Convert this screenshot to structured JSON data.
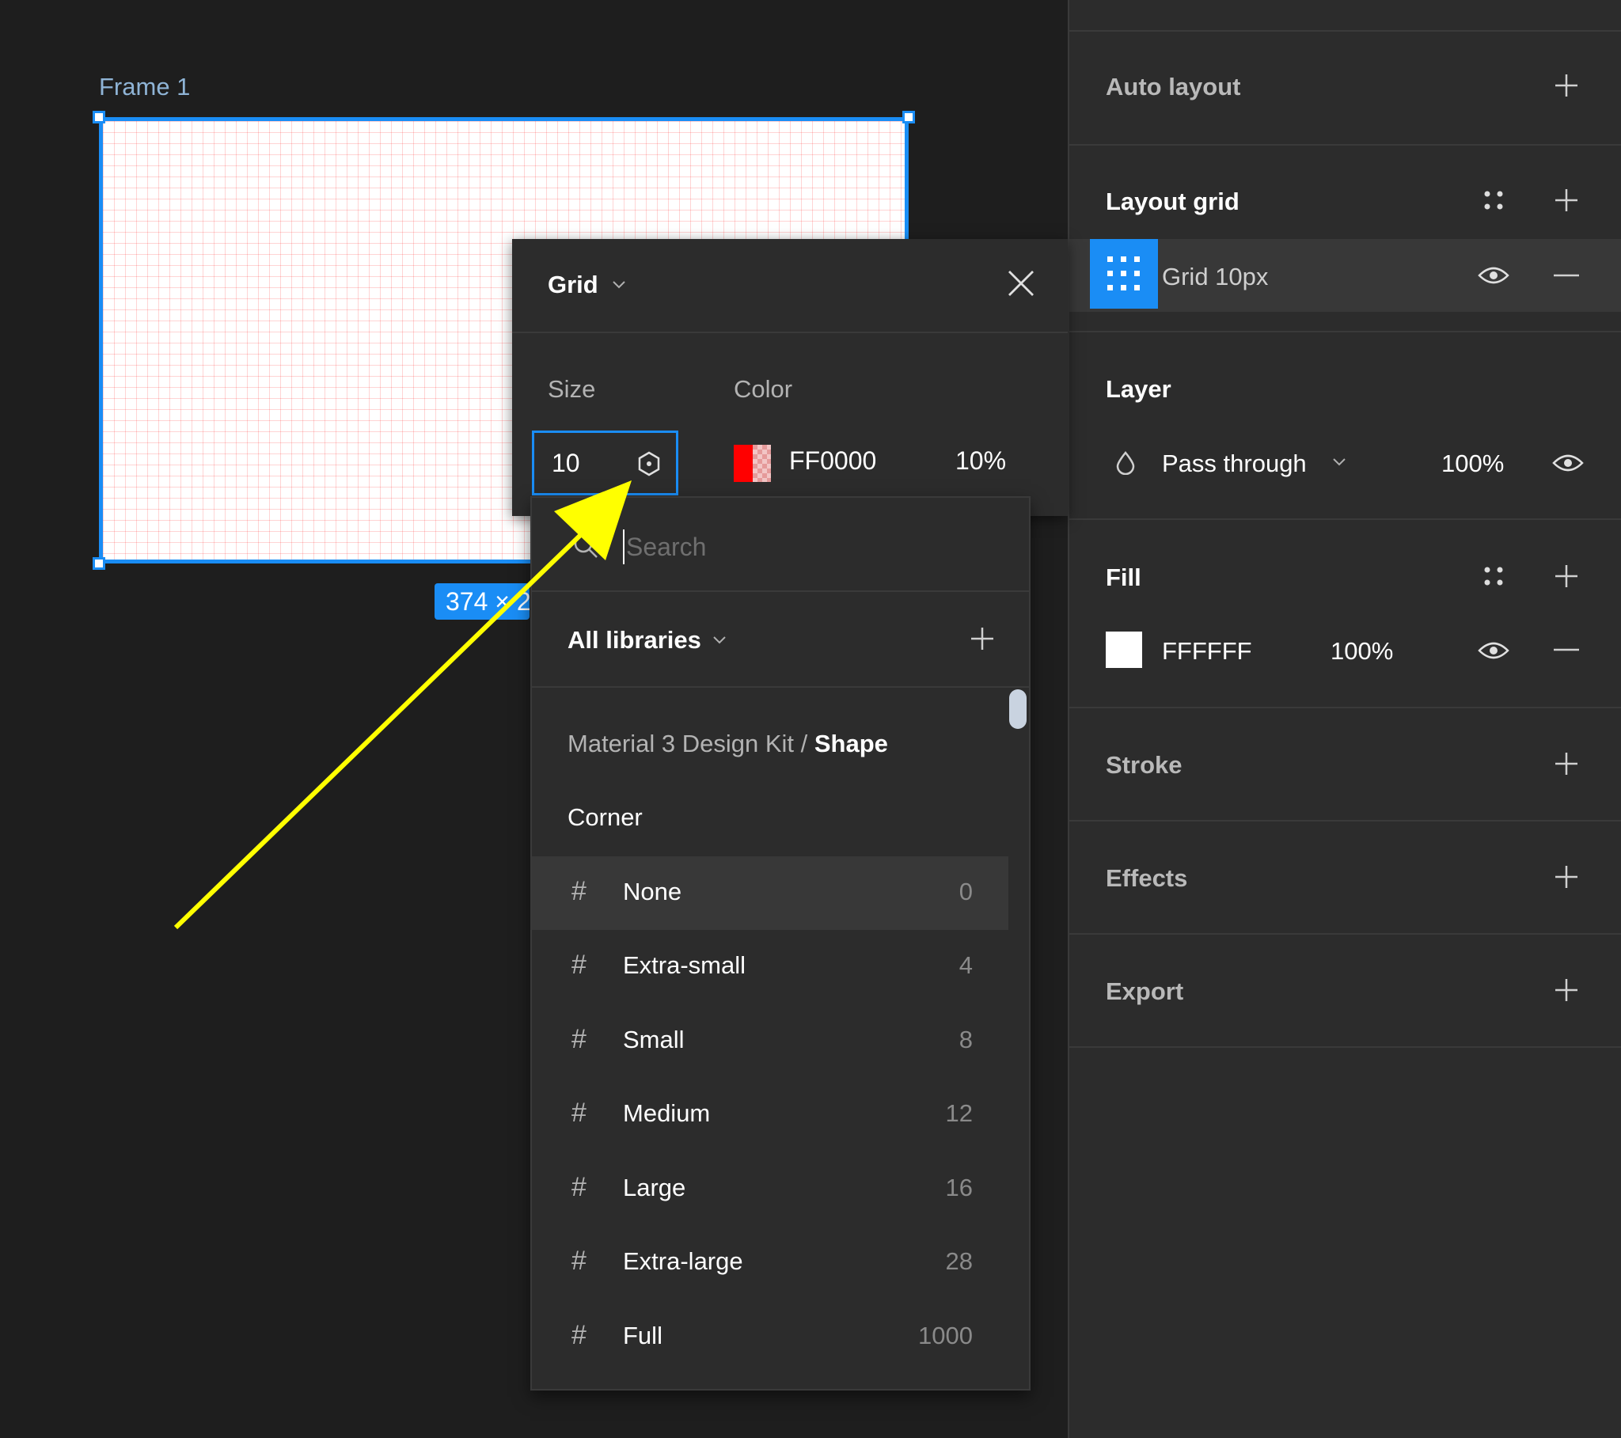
{
  "canvas": {
    "frame_label": "Frame 1",
    "size_badge": "374 × 2"
  },
  "right_panel": {
    "auto_layout": {
      "title": "Auto layout",
      "add_icon": "plus-icon"
    },
    "layout_grid": {
      "title": "Layout grid",
      "grid_item": {
        "name": "Grid 10px",
        "icon": "grid-icon"
      }
    },
    "layer": {
      "title": "Layer",
      "blend_mode": "Pass through",
      "opacity": "100%"
    },
    "fill": {
      "title": "Fill",
      "hex": "FFFFFF",
      "opacity": "100%",
      "swatch_color": "#FFFFFF"
    },
    "stroke": {
      "title": "Stroke"
    },
    "effects": {
      "title": "Effects"
    },
    "export": {
      "title": "Export"
    }
  },
  "grid_popover": {
    "title": "Grid",
    "size_label": "Size",
    "color_label": "Color",
    "size_value": "10",
    "color_hex": "FF0000",
    "color_opacity": "10%",
    "swatch_color": "#FF0000"
  },
  "variables_dropdown": {
    "search_placeholder": "Search",
    "library_filter": "All libraries",
    "breadcrumb_collection": "Material 3 Design Kit / ",
    "breadcrumb_group": "Shape",
    "group_label": "Corner",
    "items": [
      {
        "name": "None",
        "value": "0"
      },
      {
        "name": "Extra-small",
        "value": "4"
      },
      {
        "name": "Small",
        "value": "8"
      },
      {
        "name": "Medium",
        "value": "12"
      },
      {
        "name": "Large",
        "value": "16"
      },
      {
        "name": "Extra-large",
        "value": "28"
      },
      {
        "name": "Full",
        "value": "1000"
      }
    ]
  },
  "colors": {
    "accent": "#1A8DF5",
    "panel_bg": "#2C2C2C",
    "canvas_bg": "#1E1E1E",
    "annotation_arrow": "#FFFF00"
  }
}
